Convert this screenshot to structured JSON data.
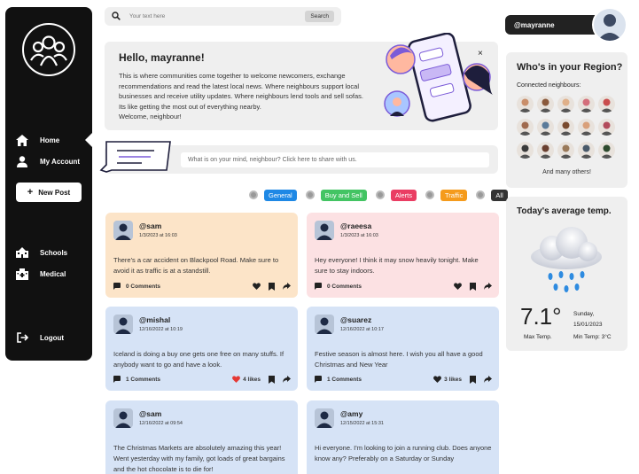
{
  "search": {
    "placeholder": "Your text here",
    "button_label": "Search"
  },
  "sidebar": {
    "items": [
      {
        "label": "Home",
        "icon": "home-icon"
      },
      {
        "label": "My Account",
        "icon": "user-icon"
      },
      {
        "label": "Schools",
        "icon": "school-icon"
      },
      {
        "label": "Medical",
        "icon": "hospital-icon"
      },
      {
        "label": "Logout",
        "icon": "logout-icon"
      }
    ],
    "new_post_label": "New Post"
  },
  "welcome": {
    "title": "Hello, mayranne!",
    "body": "This is where communities come together to welcome newcomers, exchange recommendations and read the latest local news. Where neighbours support local businesses and receive utility updates. Where neighbours lend tools and sell sofas. Its like getting the most out of everything nearby.",
    "greeting": "Welcome, neighbour!",
    "close": "×"
  },
  "share": {
    "placeholder": "What is on your mind, neighbour? Click here to share with us."
  },
  "filters": [
    {
      "label": "General",
      "color": "#1e88e5"
    },
    {
      "label": "Buy and Sell",
      "color": "#43c463"
    },
    {
      "label": "Alerts",
      "color": "#ea3d63"
    },
    {
      "label": "Traffic",
      "color": "#f59b1c"
    },
    {
      "label": "All",
      "color": "#333333"
    }
  ],
  "posts": [
    {
      "user": "@sam",
      "date": "1/3/2023 at 16:03",
      "text": "There's a car accident on Blackpool Road. Make sure to avoid it as traffic is at a standstill.",
      "comments": "0 Comments",
      "likes": "",
      "color": "orange"
    },
    {
      "user": "@raeesa",
      "date": "1/3/2023 at 16:03",
      "text": "Hey everyone! I think it may snow heavily tonight. Make sure to stay indoors.",
      "comments": "0 Comments",
      "likes": "",
      "color": "pink"
    },
    {
      "user": "@mishal",
      "date": "12/16/2022 at 10:19",
      "text": "Iceland is doing a buy one gets one free on many stuffs. If anybody want to go and have a look.",
      "comments": "1 Comments",
      "likes": "4 likes",
      "liked": true,
      "color": "blue"
    },
    {
      "user": "@suarez",
      "date": "12/16/2022 at 10:17",
      "text": "Festive season is almost here. I wish you all have a good Christmas and New Year",
      "comments": "1 Comments",
      "likes": "3 likes",
      "liked": false,
      "color": "blue"
    },
    {
      "user": "@sam",
      "date": "12/16/2022 at 09:54",
      "text": "The Christmas Markets are absolutely amazing this year! Went yesterday with my family, got loads of great bargains and the hot chocolate is to die for!",
      "comments": "",
      "likes": "",
      "color": "blue"
    },
    {
      "user": "@amy",
      "date": "12/15/2022 at 15:31",
      "text": "Hi everyone. I'm looking to join a running club. Does anyone know any? Preferably on a Saturday or Sunday",
      "comments": "",
      "likes": "",
      "color": "blue"
    }
  ],
  "user": {
    "handle": "@mayranne"
  },
  "region": {
    "title": "Who's in your Region?",
    "subtitle": "Connected neighbours:",
    "more": "And many others!",
    "neighbour_colors": [
      "#c98e6a",
      "#8b5a3c",
      "#e0b089",
      "#d46e7a",
      "#c94c4c",
      "#a06a4e",
      "#5b7b9a",
      "#7a4a2e",
      "#d9a07a",
      "#b24a5a",
      "#3a3a3a",
      "#6a4030",
      "#9a7a5a",
      "#4a5a6a",
      "#2e4a2e"
    ]
  },
  "weather": {
    "title": "Today's average temp.",
    "temp": "7.1°",
    "day": "Sunday,",
    "date": "15/01/2023",
    "max_label": "Max Temp.",
    "min_label": "Min Temp: 3°C"
  }
}
